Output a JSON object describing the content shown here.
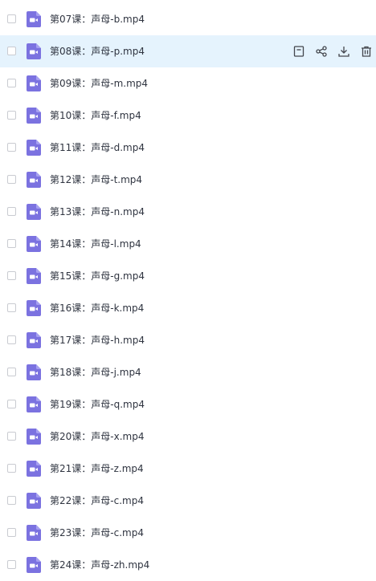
{
  "files": [
    {
      "name": "第07课：声母-b.mp4",
      "type_icon": "video-file-icon",
      "hovered": false
    },
    {
      "name": "第08课：声母-p.mp4",
      "type_icon": "video-file-icon",
      "hovered": true
    },
    {
      "name": "第09课：声母-m.mp4",
      "type_icon": "video-file-icon",
      "hovered": false
    },
    {
      "name": "第10课：声母-f.mp4",
      "type_icon": "video-file-icon",
      "hovered": false
    },
    {
      "name": "第11课：声母-d.mp4",
      "type_icon": "video-file-icon",
      "hovered": false
    },
    {
      "name": "第12课：声母-t.mp4",
      "type_icon": "video-file-icon",
      "hovered": false
    },
    {
      "name": "第13课：声母-n.mp4",
      "type_icon": "video-file-icon",
      "hovered": false
    },
    {
      "name": "第14课：声母-l.mp4",
      "type_icon": "video-file-icon",
      "hovered": false
    },
    {
      "name": "第15课：声母-g.mp4",
      "type_icon": "video-file-icon",
      "hovered": false
    },
    {
      "name": "第16课：声母-k.mp4",
      "type_icon": "video-file-icon",
      "hovered": false
    },
    {
      "name": "第17课：声母-h.mp4",
      "type_icon": "video-file-icon",
      "hovered": false
    },
    {
      "name": "第18课：声母-j.mp4",
      "type_icon": "video-file-icon",
      "hovered": false
    },
    {
      "name": "第19课：声母-q.mp4",
      "type_icon": "video-file-icon",
      "hovered": false
    },
    {
      "name": "第20课：声母-x.mp4",
      "type_icon": "video-file-icon",
      "hovered": false
    },
    {
      "name": "第21课：声母-z.mp4",
      "type_icon": "video-file-icon",
      "hovered": false
    },
    {
      "name": "第22课：声母-c.mp4",
      "type_icon": "video-file-icon",
      "hovered": false
    },
    {
      "name": "第23课：声母-c.mp4",
      "type_icon": "video-file-icon",
      "hovered": false
    },
    {
      "name": "第24课：声母-zh.mp4",
      "type_icon": "video-file-icon",
      "hovered": false
    }
  ],
  "hover_actions": [
    "save-to-folder-icon",
    "share-icon",
    "download-icon",
    "delete-icon"
  ],
  "colors": {
    "icon_purple": "#7b72e0",
    "icon_white": "#ffffff",
    "hover_background": "#e5f3fd",
    "action_icon": "#43464d",
    "text": "#2f3440"
  }
}
